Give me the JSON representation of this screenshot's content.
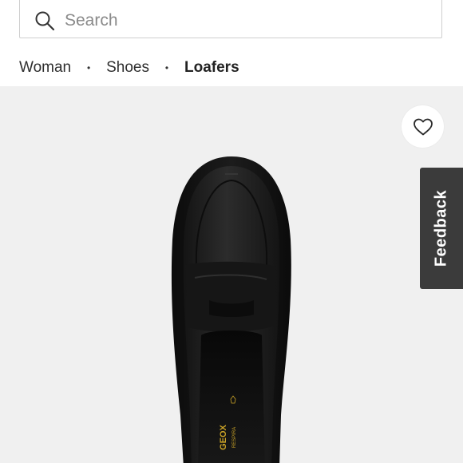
{
  "search": {
    "placeholder": "Search",
    "value": ""
  },
  "breadcrumb": {
    "items": [
      {
        "label": "Woman"
      },
      {
        "label": "Shoes"
      },
      {
        "label": "Loafers"
      }
    ],
    "separator": "•"
  },
  "product": {
    "image_subject": "black leather penny loafer, top view",
    "insole_brand_text": "GEOX",
    "insole_sub_text": "RESPIRA"
  },
  "wishlist": {
    "icon": "heart-outline-icon"
  },
  "feedback": {
    "label": "Feedback"
  },
  "colors": {
    "image_background": "#f0f0f0",
    "feedback_bg": "#3b3b3b",
    "insole_print": "#c9a227"
  }
}
